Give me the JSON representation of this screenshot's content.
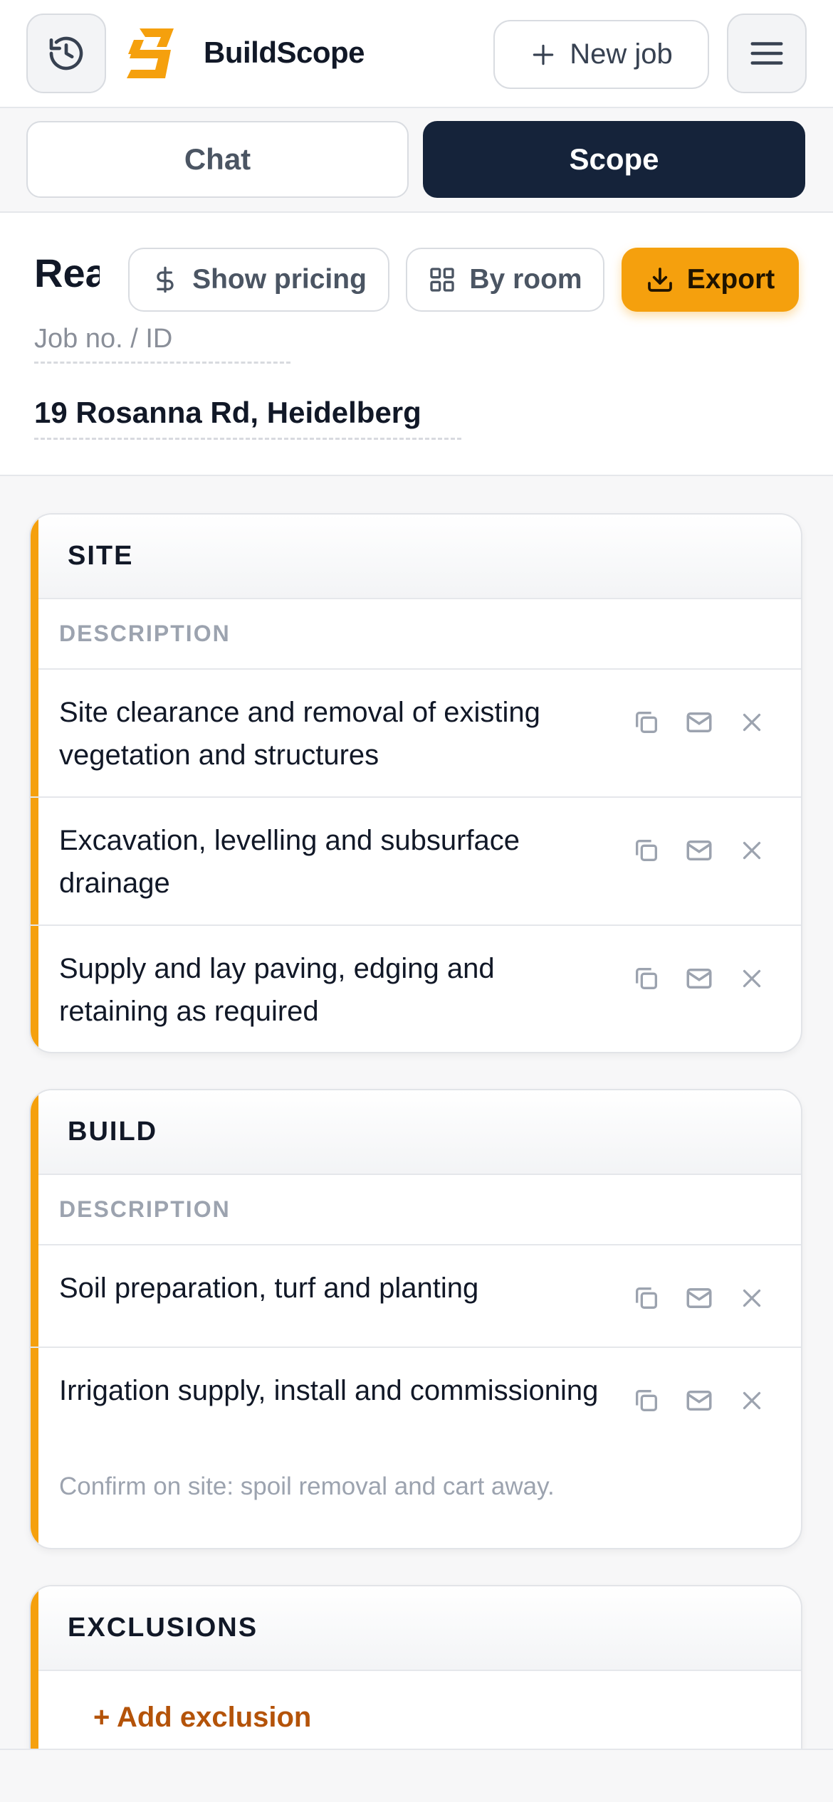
{
  "app": {
    "brand": "BuildScope"
  },
  "header": {
    "new_job_label": "New job"
  },
  "tabs": [
    {
      "label": "Chat"
    },
    {
      "label": "Scope"
    }
  ],
  "toolbar": {
    "title_visible": "Rea",
    "show_pricing_label": "Show pricing",
    "by_room_label": "By room",
    "export_label": "Export"
  },
  "job": {
    "id_placeholder": "Job no. / ID",
    "address": "19 Rosanna Rd, Heidelberg"
  },
  "sections": [
    {
      "title": "SITE",
      "column_header": "DESCRIPTION",
      "items": [
        {
          "text": "Site clearance and removal of existing vegetation and structures"
        },
        {
          "text": "Excavation, levelling and subsurface drainage"
        },
        {
          "text": "Supply and lay paving, edging and retaining as required"
        }
      ]
    },
    {
      "title": "BUILD",
      "column_header": "DESCRIPTION",
      "items": [
        {
          "text": "Soil preparation, turf and planting"
        },
        {
          "text": "Irrigation supply, install and commissioning",
          "note": "Confirm on site: spoil removal and cart away."
        }
      ]
    },
    {
      "title": "EXCLUSIONS",
      "add_label": "+ Add exclusion"
    }
  ],
  "colors": {
    "accent": "#f5a00d",
    "navy": "#15233a",
    "add_link": "#b45309"
  },
  "icons": {
    "history": "history-icon",
    "logo": "buildscope-logo",
    "plus": "plus-icon",
    "menu": "hamburger-menu-icon",
    "pricing": "dollar-icon",
    "room": "grid-icon",
    "export": "download-icon",
    "copy": "copy-icon",
    "mail": "mail-icon",
    "remove": "close-icon"
  }
}
